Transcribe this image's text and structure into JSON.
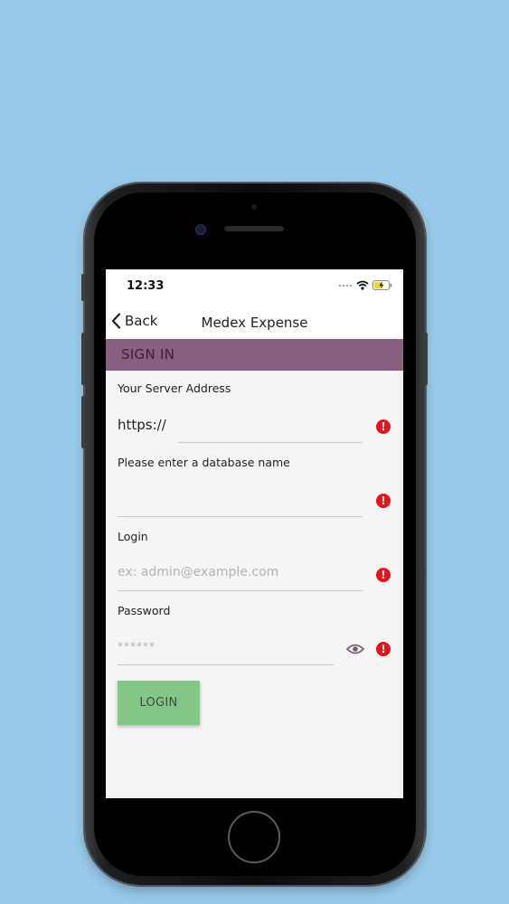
{
  "status": {
    "time": "12:33"
  },
  "nav": {
    "back_label": "Back",
    "title": "Medex Expense"
  },
  "section": {
    "title": "SIGN IN"
  },
  "form": {
    "server": {
      "label": "Your Server Address",
      "prefix": "https://",
      "value": ""
    },
    "database": {
      "label": "Please enter a database name",
      "value": ""
    },
    "login": {
      "label": "Login",
      "placeholder": "ex: admin@example.com"
    },
    "password": {
      "label": "Password",
      "placeholder": "******"
    },
    "error_glyph": "!",
    "submit_label": "LOGIN"
  },
  "colors": {
    "background": "#98c9e8",
    "header_bar": "#8a5e7e",
    "login_button": "#82c785",
    "error": "#e3141b"
  }
}
